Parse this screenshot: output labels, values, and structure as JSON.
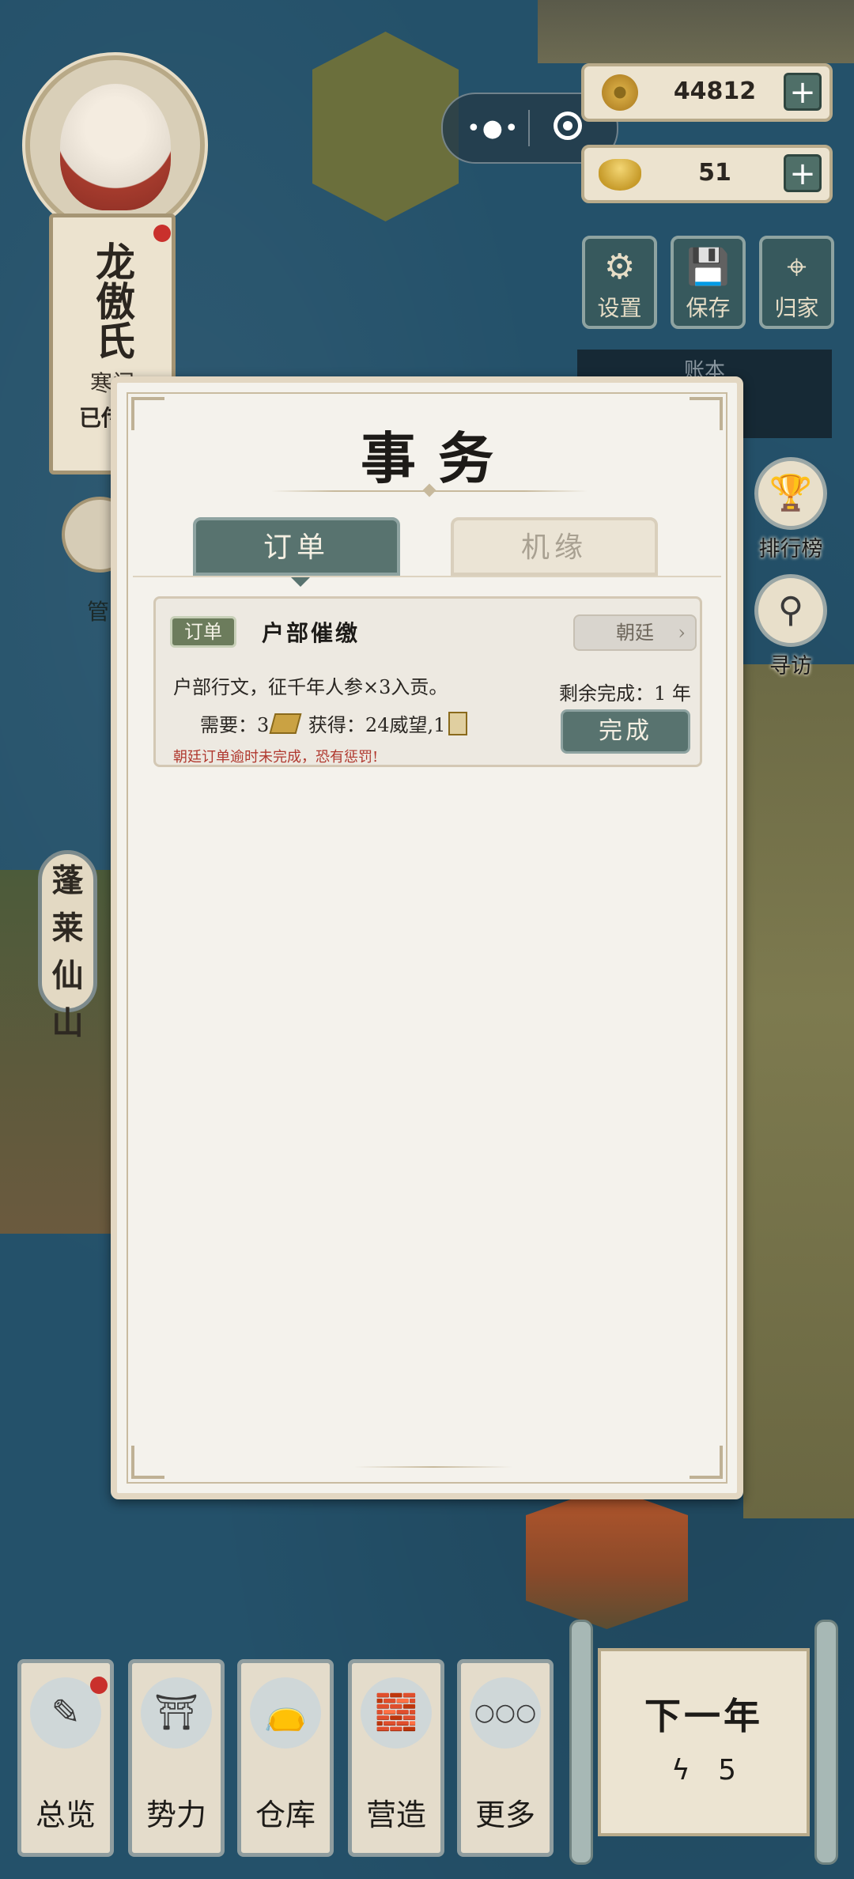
{
  "resources": {
    "coins": "44812",
    "ingots": "51",
    "plus": "+"
  },
  "toolbar": [
    {
      "icon": "⚙",
      "label": "设置",
      "icon_name": "gear-icon"
    },
    {
      "icon": "💾",
      "label": "保存",
      "icon_name": "save-icon"
    },
    {
      "icon": "⌖",
      "label": "归家",
      "icon_name": "location-pin-icon"
    }
  ],
  "ledger_label": "账本",
  "player": {
    "name": "龙傲氏",
    "rank": "寒门",
    "status": "已传承"
  },
  "steward_label": "管",
  "place_name": "蓬莱仙山",
  "side_buttons": [
    {
      "icon": "🏆",
      "label": "排行榜",
      "icon_name": "trophy-icon"
    },
    {
      "icon": "⚲",
      "label": "寻访",
      "icon_name": "magnifier-icon"
    }
  ],
  "modal": {
    "title": "事务",
    "tabs": [
      {
        "label": "订单",
        "active": true
      },
      {
        "label": "机缘",
        "active": false
      }
    ],
    "order": {
      "badge": "订单",
      "title": "户部催缴",
      "source": "朝廷",
      "description": "户部行文，征千年人参×3入贡。",
      "need_label": "需要：",
      "need_amount": "3",
      "gain_label": "获得：",
      "gain_text": "24威望,1",
      "remaining": "剩余完成：1 年",
      "complete_button": "完成",
      "warning": "朝廷订单逾时未完成，恐有惩罚!"
    }
  },
  "menu": [
    {
      "label": "总览",
      "icon": "✎",
      "icon_name": "scroll-brush-icon"
    },
    {
      "label": "势力",
      "icon": "⛩",
      "icon_name": "palace-icon"
    },
    {
      "label": "仓库",
      "icon": "👝",
      "icon_name": "money-bag-icon"
    },
    {
      "label": "营造",
      "icon": "🧱",
      "icon_name": "bricks-trowel-icon"
    },
    {
      "label": "更多",
      "icon": "○○○",
      "icon_name": "more-dots-icon"
    }
  ],
  "next_year": {
    "label": "下一年",
    "energy_icon": "ϟ",
    "energy": "5"
  }
}
